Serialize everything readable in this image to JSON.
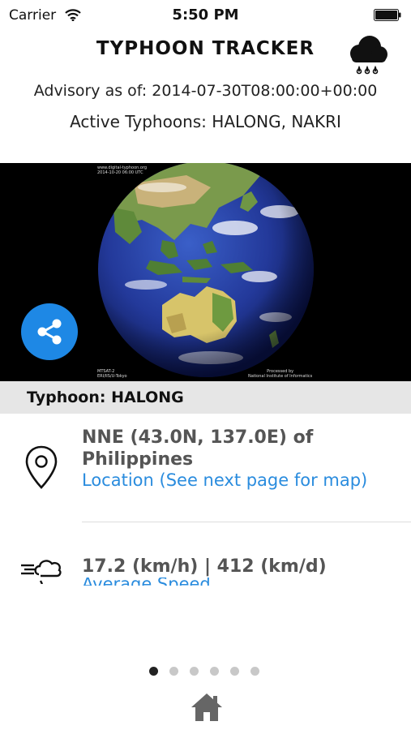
{
  "status_bar": {
    "carrier": "Carrier",
    "time": "5:50 PM",
    "icons": [
      "wifi-icon",
      "battery-icon"
    ]
  },
  "header": {
    "title": "TYPHOON TRACKER",
    "icon": "cloud-rain-icon",
    "advisory": "Advisory as of: 2014-07-30T08:00:00+00:00",
    "active_typhoons": "Active Typhoons: HALONG, NAKRI"
  },
  "satellite_image": {
    "caption_top": "www.digital-typhoon.org\n2014-10-20 06:00 UTC",
    "caption_bottom_left": "MTSAT-2\nERI/IIS/U-Tokyo",
    "caption_bottom_right": "Processed by\nNational Institute of Informatics",
    "share_icon": "share-icon"
  },
  "section": {
    "title": "Typhoon: HALONG"
  },
  "details": [
    {
      "icon": "location-pin-icon",
      "value": "NNE (43.0N, 137.0E) of Philippines",
      "label": "Location (See next page for map)"
    },
    {
      "icon": "wind-cloud-icon",
      "value": "17.2 (km/h) | 412 (km/d)",
      "label": "Average Speed"
    }
  ],
  "pager": {
    "pages": 6,
    "current": 1
  },
  "bottom": {
    "icon": "home-icon"
  },
  "colors": {
    "link": "#2a8cde",
    "share_button": "#1e88e5",
    "section_bg": "#e6e6e6"
  }
}
